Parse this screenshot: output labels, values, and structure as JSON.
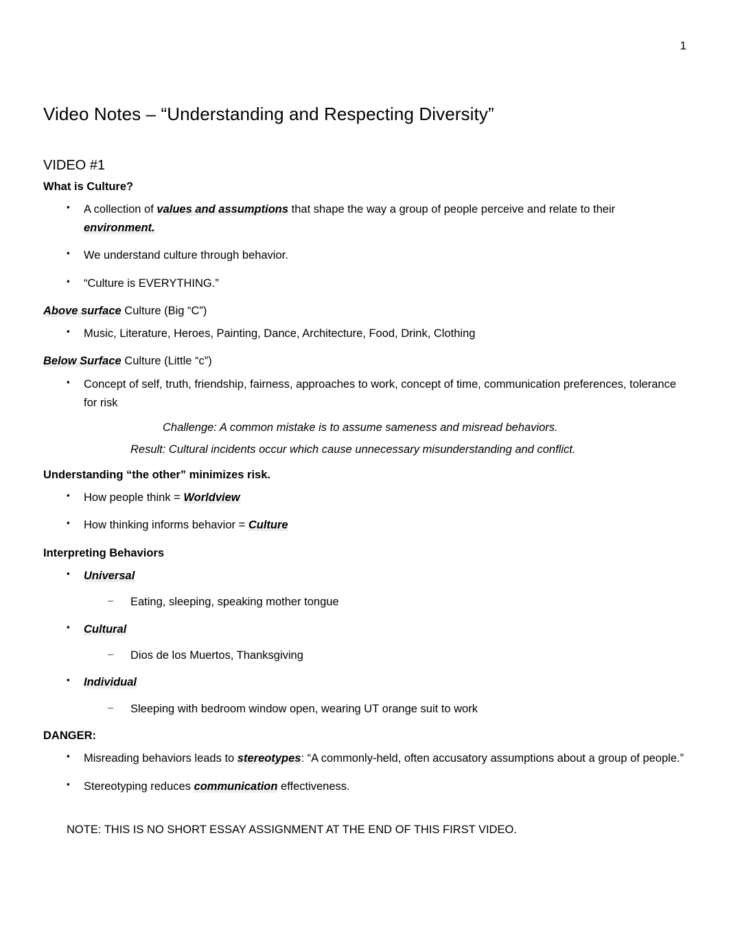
{
  "page": {
    "number": "1",
    "title": "Video Notes – “Understanding and Respecting Diversity”"
  },
  "video_section": {
    "label": "VIDEO #1"
  },
  "what_is_culture": {
    "heading": "What is Culture?",
    "bullets": {
      "b1_pre": "A collection of ",
      "b1_em1": "values and assumptions",
      "b1_mid": " that shape the way a group of people perceive and relate to their ",
      "b1_em2": "environment.",
      "b2": "We understand culture through behavior.",
      "b3": "“Culture is EVERYTHING.”"
    }
  },
  "above_surface": {
    "heading_em": "Above surface",
    "heading_rest": " Culture (Big “C”)",
    "bullet": "Music, Literature, Heroes, Painting, Dance, Architecture, Food, Drink, Clothing"
  },
  "below_surface": {
    "heading_em": "Below Surface",
    "heading_rest": " Culture (Little “c”)",
    "bullet": "Concept of self, truth, friendship, fairness, approaches to work, concept of time, communication preferences, tolerance for risk",
    "challenge": "Challenge:  A common mistake is to assume sameness and misread behaviors.",
    "result": "Result:  Cultural incidents occur which cause unnecessary misunderstanding and conflict."
  },
  "understanding_other": {
    "heading": "Understanding “the other” minimizes risk.",
    "b1_pre": "How people think = ",
    "b1_em": "Worldview",
    "b2_pre": "How thinking informs behavior = ",
    "b2_em": "Culture"
  },
  "interpreting_behaviors": {
    "heading": "Interpreting Behaviors",
    "items": [
      {
        "label": "Universal",
        "example": "Eating, sleeping, speaking mother tongue"
      },
      {
        "label": "Cultural",
        "example": "Dios de los Muertos, Thanksgiving"
      },
      {
        "label": "Individual",
        "example": "Sleeping with bedroom window open, wearing UT orange suit to work"
      }
    ]
  },
  "danger": {
    "heading": "DANGER:",
    "b1_pre": "Misreading behaviors leads to  ",
    "b1_em": "stereotypes",
    "b1_post": ":  “A commonly-held, often accusatory assumptions about a group of people.”",
    "b2_pre": "Stereotyping reduces ",
    "b2_em": "communication",
    "b2_post": " effectiveness."
  },
  "closing_note": {
    "text": "NOTE:  THIS IS NO SHORT ESSAY ASSIGNMENT AT THE END OF THIS FIRST VIDEO."
  }
}
